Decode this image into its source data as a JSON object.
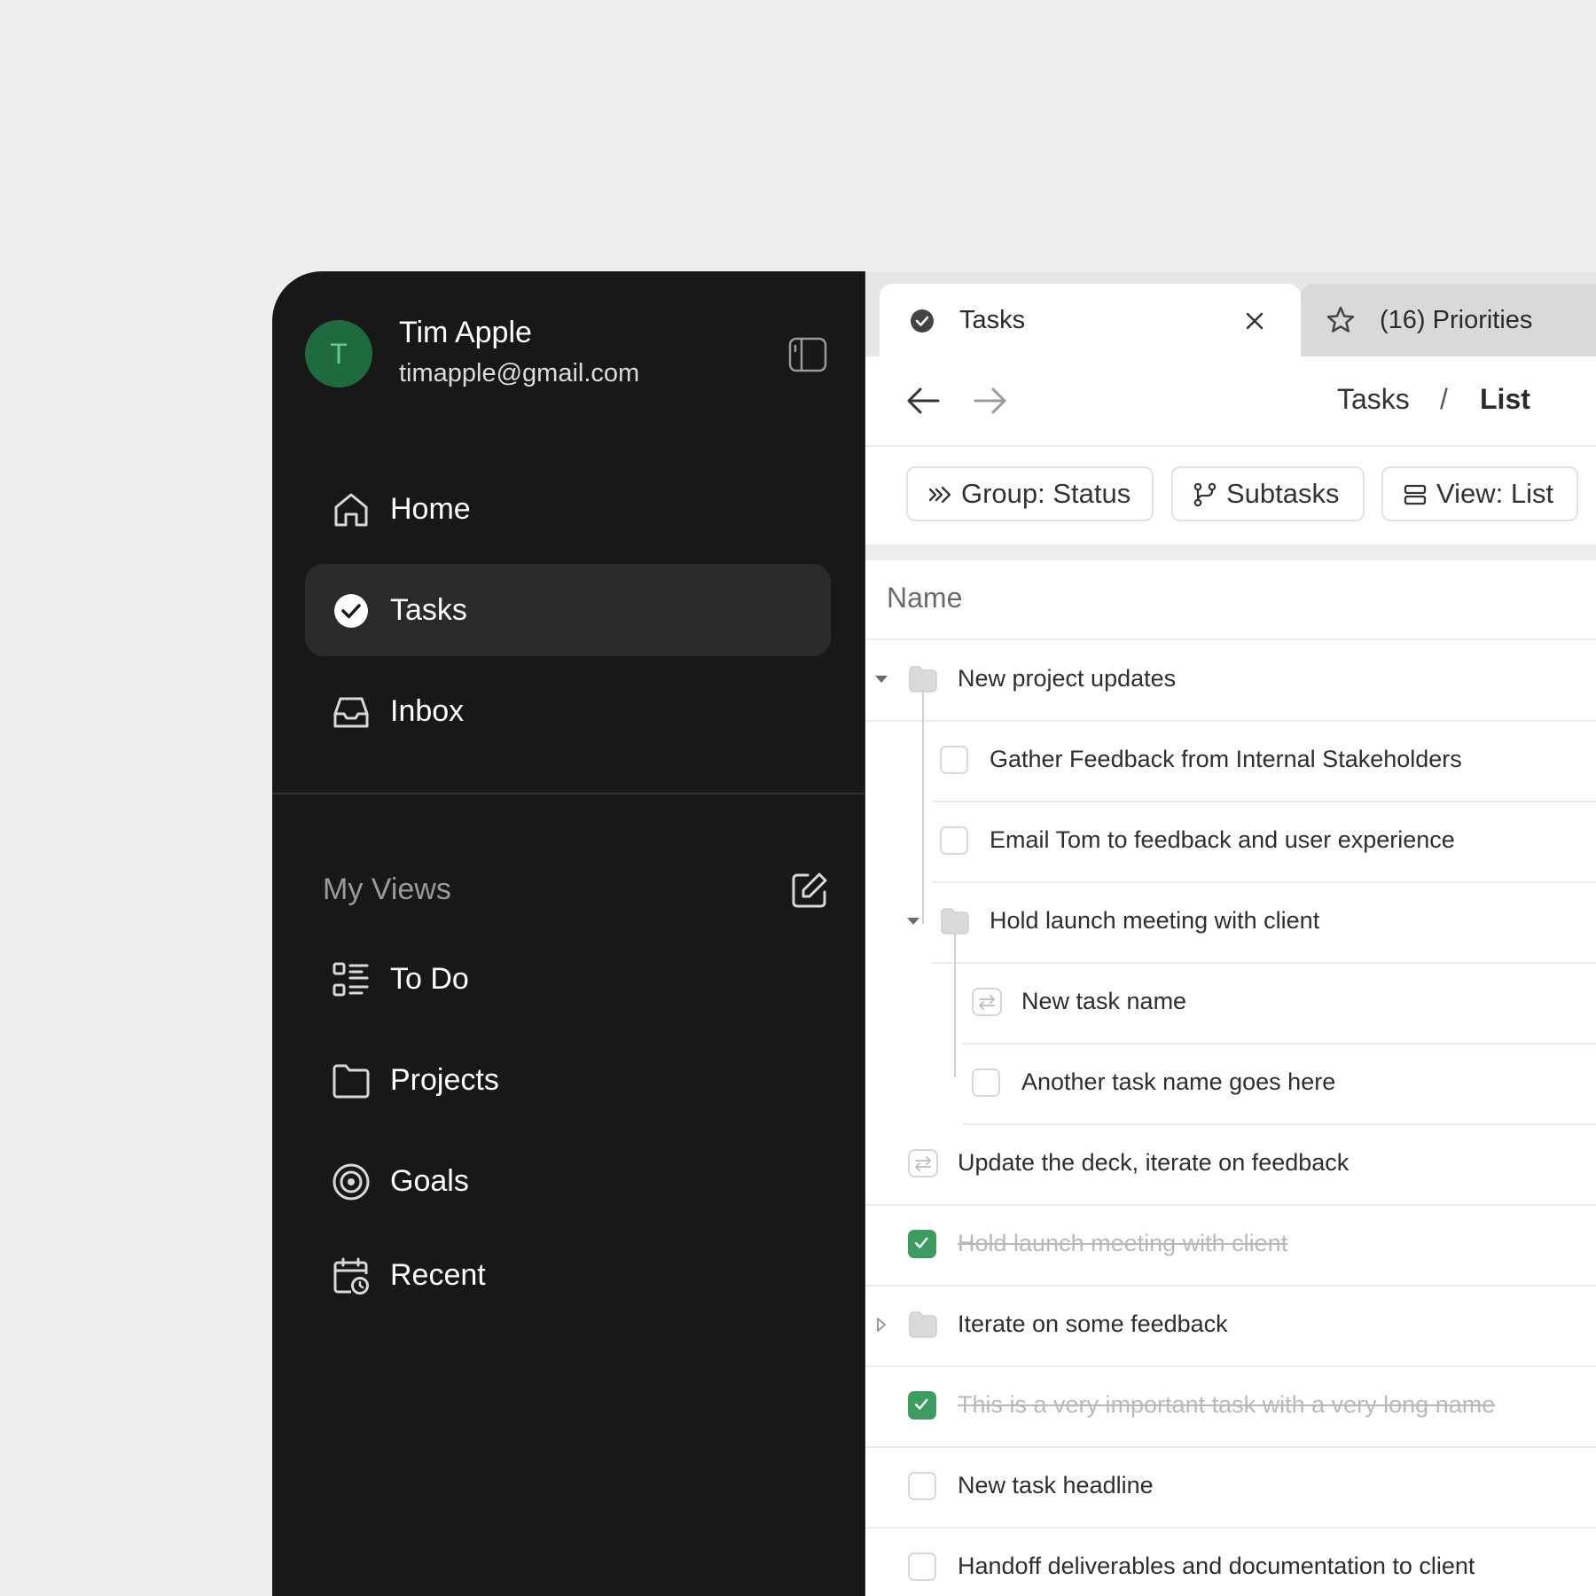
{
  "user": {
    "initial": "T",
    "name": "Tim Apple",
    "email": "timapple@gmail.com"
  },
  "sidebar": {
    "nav": [
      {
        "label": "Home",
        "icon": "home-icon"
      },
      {
        "label": "Tasks",
        "icon": "check-circle-icon",
        "active": true
      },
      {
        "label": "Inbox",
        "icon": "inbox-icon"
      }
    ],
    "views_title": "My Views",
    "views": [
      {
        "label": "To Do",
        "icon": "todo-list-icon"
      },
      {
        "label": "Projects",
        "icon": "folder-icon"
      },
      {
        "label": "Goals",
        "icon": "target-icon"
      },
      {
        "label": "Recent",
        "icon": "calendar-clock-icon"
      }
    ]
  },
  "tabs": [
    {
      "label": "Tasks",
      "icon": "check-circle-icon",
      "active": true
    },
    {
      "label": "(16) Priorities",
      "icon": "star-icon"
    }
  ],
  "breadcrumb": {
    "parent": "Tasks",
    "separator": "/",
    "current": "List"
  },
  "toolbar": {
    "group": "Group: Status",
    "subtasks": "Subtasks",
    "view": "View: List"
  },
  "table": {
    "column": "Name",
    "rows": [
      {
        "label": "New project updates",
        "type": "folder",
        "expanded": true,
        "depth": 0
      },
      {
        "label": "Gather Feedback from Internal Stakeholders",
        "type": "task",
        "depth": 1
      },
      {
        "label": "Email Tom to feedback and user experience",
        "type": "task",
        "depth": 1
      },
      {
        "label": "Hold launch meeting with client",
        "type": "folder",
        "expanded": true,
        "depth": 1
      },
      {
        "label": "New task name",
        "type": "recurring",
        "depth": 2
      },
      {
        "label": "Another task name goes here",
        "type": "task",
        "depth": 2
      },
      {
        "label": "Update the deck, iterate on feedback",
        "type": "recurring",
        "depth": 0
      },
      {
        "label": "Hold launch meeting with client",
        "type": "task",
        "done": true,
        "depth": 0
      },
      {
        "label": "Iterate on some feedback",
        "type": "folder",
        "expanded": false,
        "depth": 0
      },
      {
        "label": "This is a very important task with a very long name",
        "type": "task",
        "done": true,
        "depth": 0
      },
      {
        "label": "New task headline",
        "type": "task",
        "depth": 0
      },
      {
        "label": "Handoff deliverables and documentation to client",
        "type": "task",
        "depth": 0
      }
    ]
  },
  "colors": {
    "sidebar_bg": "#181818",
    "accent_green": "#3e9b60",
    "avatar_bg": "#1f6b3d"
  }
}
